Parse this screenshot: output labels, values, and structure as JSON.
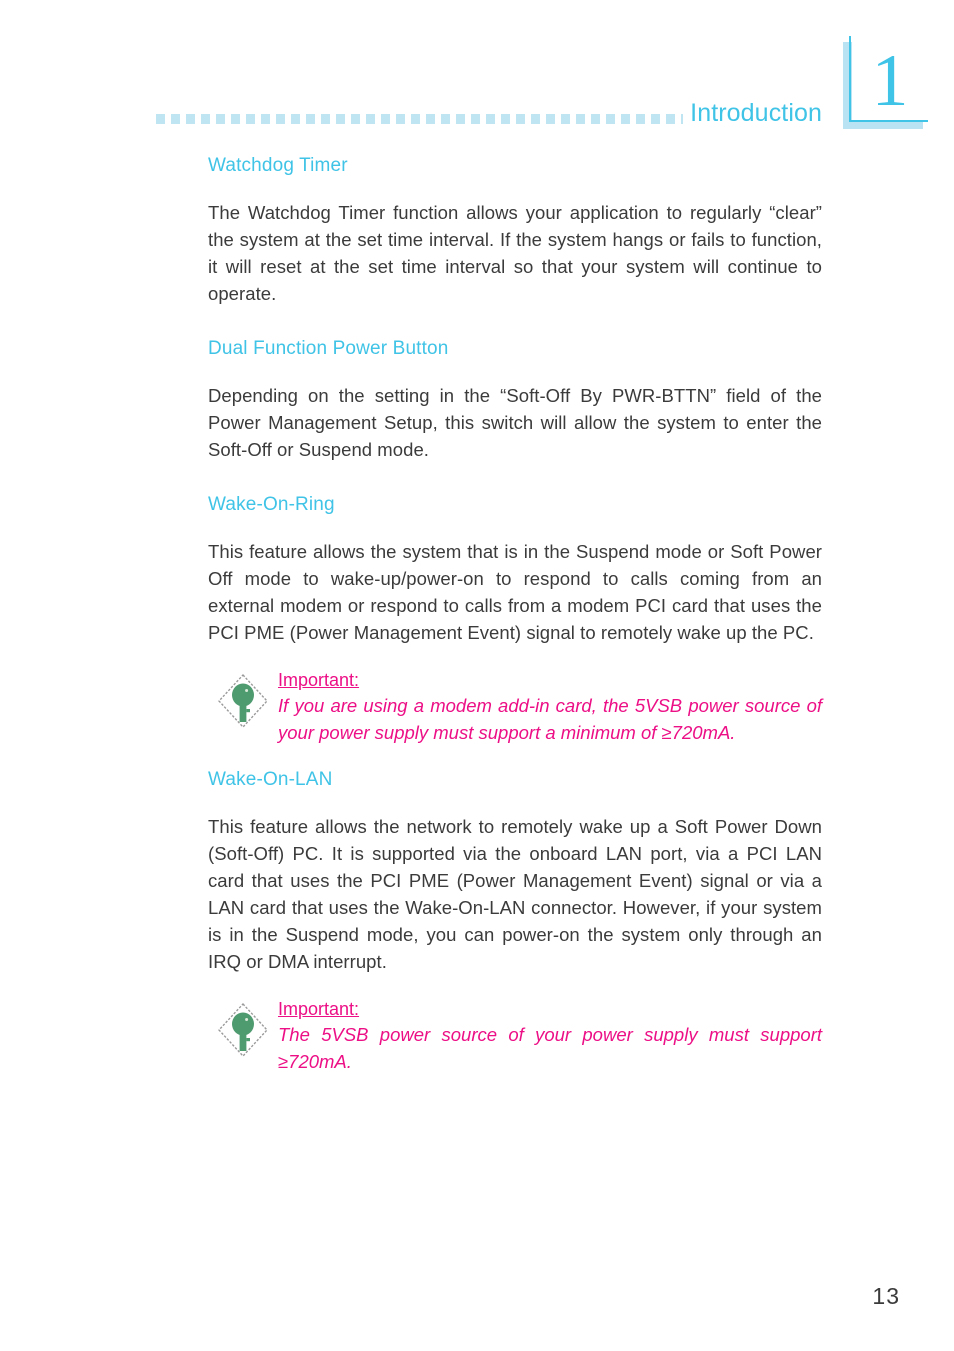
{
  "page": {
    "header_title": "Introduction",
    "chapter_number": "1",
    "page_number": "13",
    "accent_color": "#3fc3e6",
    "rule_color": "#bfe5f3",
    "note_color": "#ec0f86",
    "body_color": "#3b3b3b",
    "icon_color": "#4b9a6e"
  },
  "sections": [
    {
      "title": "Watchdog Timer",
      "body": "The Watchdog Timer function allows your application to regularly “clear” the system at the set time interval. If the system hangs or fails to function, it will reset at the set time interval so that your system will continue to operate."
    },
    {
      "title": "Dual Function Power Button",
      "body": "Depending on the setting in the “Soft-Off By PWR-BTTN” field of the Power Management Setup, this switch will allow the system to enter the Soft-Off or Suspend mode."
    },
    {
      "title": "Wake-On-Ring",
      "body": "This feature allows the system that is in the Suspend mode or Soft Power Off mode to wake-up/power-on to respond to calls coming from an external modem or respond to calls from a modem PCI card that uses the PCI PME (Power Management Event) signal to remotely wake up the PC."
    },
    {
      "title": "Wake-On-LAN",
      "body": "This feature allows the network to remotely wake up a Soft Power Down (Soft-Off) PC. It is supported via the onboard LAN port, via a PCI LAN card that uses the PCI PME (Power Management Event) signal or via a LAN card that uses the Wake-On-LAN connector. However, if your system is in the Suspend mode, you can power-on the system only through an IRQ or DMA interrupt."
    }
  ],
  "notes": [
    {
      "label": "Important:",
      "body": "If you are using a modem add-in card, the 5VSB power source of your power supply must support a minimum of ≥720mA.",
      "icon": "key-diamond-icon"
    },
    {
      "label": "Important:",
      "body": "The 5VSB power source of your power supply must support ≥720mA.",
      "icon": "key-diamond-icon"
    }
  ]
}
